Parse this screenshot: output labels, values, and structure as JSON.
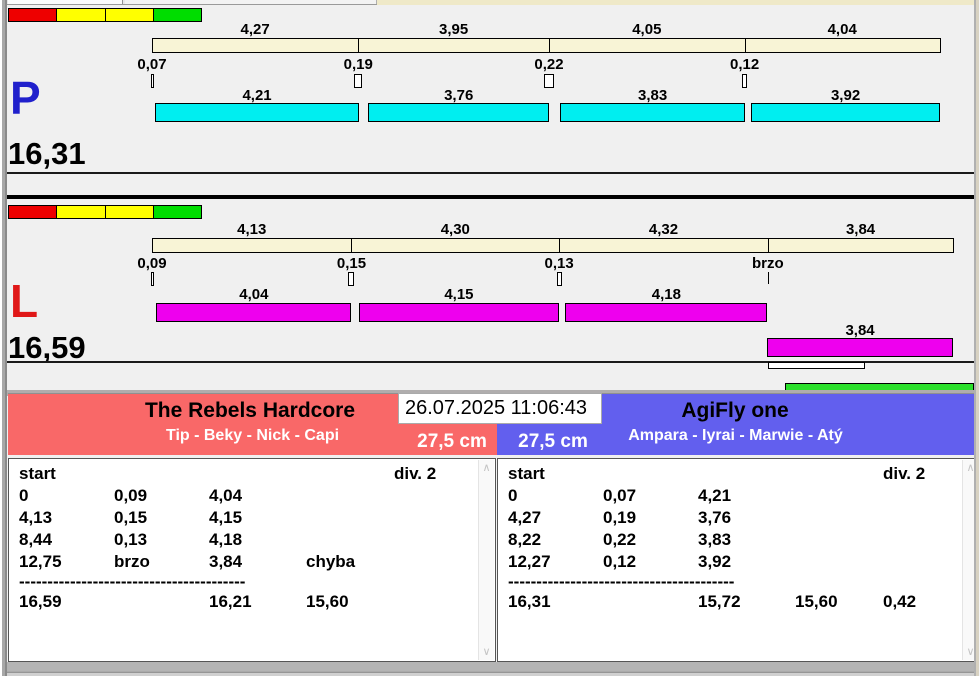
{
  "status_blocks": [
    "#ee0000",
    "#ffff00",
    "#ffff00",
    "#00dd00"
  ],
  "colors": {
    "split_bar": "#f8f4d6",
    "lane_p_runs": "#00eef0",
    "lane_l_runs": "#ee00ee",
    "team_left_bg": "#f96868",
    "team_right_bg": "#625fee"
  },
  "lanes": [
    {
      "letter": "P",
      "letter_color": "#2020cc",
      "total": "16,31",
      "run_color": "#00eef0",
      "splits": [
        {
          "label": "4,27",
          "seconds": 4.27
        },
        {
          "label": "3,95",
          "seconds": 3.95
        },
        {
          "label": "4,05",
          "seconds": 4.05
        },
        {
          "label": "4,04",
          "seconds": 4.04
        }
      ],
      "gaps": [
        {
          "label": "0,07",
          "seconds": 0.07
        },
        {
          "label": "0,19",
          "seconds": 0.19
        },
        {
          "label": "0,22",
          "seconds": 0.22
        },
        {
          "label": "0,12",
          "seconds": 0.12
        }
      ],
      "runs": [
        {
          "label": "4,21",
          "seconds": 4.21
        },
        {
          "label": "3,76",
          "seconds": 3.76
        },
        {
          "label": "3,83",
          "seconds": 3.83
        },
        {
          "label": "3,92",
          "seconds": 3.92
        }
      ]
    },
    {
      "letter": "L",
      "letter_color": "#e01818",
      "total": "16,59",
      "run_color": "#ee00ee",
      "splits": [
        {
          "label": "4,13",
          "seconds": 4.13
        },
        {
          "label": "4,30",
          "seconds": 4.3
        },
        {
          "label": "4,32",
          "seconds": 4.32
        },
        {
          "label": "3,84",
          "seconds": 3.84
        }
      ],
      "gaps": [
        {
          "label": "0,09",
          "seconds": 0.09
        },
        {
          "label": "0,15",
          "seconds": 0.15
        },
        {
          "label": "0,13",
          "seconds": 0.13
        },
        {
          "label": "brzo",
          "seconds": null
        }
      ],
      "runs": [
        {
          "label": "4,04",
          "seconds": 4.04
        },
        {
          "label": "4,15",
          "seconds": 4.15
        },
        {
          "label": "4,18",
          "seconds": 4.18
        },
        {
          "label": "3,84",
          "seconds": 3.84,
          "row": 2
        }
      ]
    }
  ],
  "footer": {
    "datetime": "26.07.2025 11:06:43",
    "teams": [
      {
        "name": "The Rebels Hardcore",
        "members": "Tip - Beky - Nick - Capi",
        "jump_height": "27,5 cm",
        "table": {
          "col1_header": "start",
          "col5_header": "div. 2",
          "rows": [
            [
              "0",
              "0,09",
              "4,04",
              "",
              ""
            ],
            [
              "4,13",
              "0,15",
              "4,15",
              "",
              ""
            ],
            [
              "8,44",
              "0,13",
              "4,18",
              "",
              ""
            ],
            [
              "12,75",
              "brzo",
              "3,84",
              "chyba",
              ""
            ]
          ],
          "separator": "----------------------------------------",
          "totals": [
            "16,59",
            "",
            "16,21",
            "15,60",
            ""
          ]
        }
      },
      {
        "name": "AgiFly one",
        "members": "Ampara - Iyrai - Marwie - Atý",
        "jump_height": "27,5 cm",
        "table": {
          "col1_header": "start",
          "col5_header": "div. 2",
          "rows": [
            [
              "0",
              "0,07",
              "4,21",
              "",
              ""
            ],
            [
              "4,27",
              "0,19",
              "3,76",
              "",
              ""
            ],
            [
              "8,22",
              "0,22",
              "3,83",
              "",
              ""
            ],
            [
              "12,27",
              "0,12",
              "3,92",
              "",
              ""
            ]
          ],
          "separator": "----------------------------------------",
          "totals": [
            "16,31",
            "",
            "15,72",
            "15,60",
            "0,42"
          ]
        }
      }
    ]
  },
  "scrollbar": {
    "up_glyph": "∧",
    "down_glyph": "∨"
  }
}
